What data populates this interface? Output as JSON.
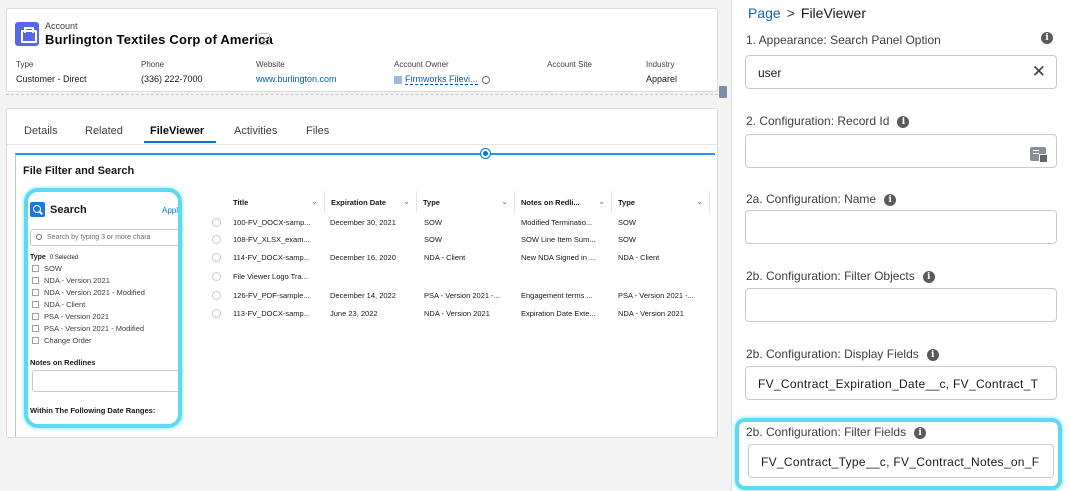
{
  "record": {
    "object_type": "Account",
    "name": "Burlington Textiles Corp of America",
    "hierarchy_icon": "hierarchy-icon",
    "fields": [
      {
        "label": "Type",
        "value": "Customer - Direct"
      },
      {
        "label": "Phone",
        "value": "(336) 222-7000"
      },
      {
        "label": "Website",
        "value": "www.burlington.com"
      },
      {
        "label": "Account Owner",
        "value": "Firmworks Filevi..."
      },
      {
        "label": "Account Site",
        "value": ""
      },
      {
        "label": "Industry",
        "value": "Apparel"
      }
    ]
  },
  "tabs": [
    "Details",
    "Related",
    "FileViewer",
    "Activities",
    "Files"
  ],
  "active_tab": "FileViewer",
  "component": {
    "title": "File Filter and Search",
    "search": {
      "title": "Search",
      "apply_label": "Appl",
      "placeholder": "Search by typing 3 or more chara",
      "type_label": "Type",
      "selected_count": "0 Selected",
      "options": [
        "SOW",
        "NDA - Version 2021",
        "NDA - Version 2021 - Modified",
        "NDA - Client",
        "PSA - Version 2021",
        "PSA - Version 2021 - Modified",
        "Change Order"
      ],
      "notes_label": "Notes on Redlines",
      "date_label": "Within The Following Date Ranges:"
    },
    "table": {
      "columns": [
        "Title",
        "Expiration Date",
        "Type",
        "Notes on Redli...",
        "Type"
      ],
      "rows": [
        [
          "100-FV_DOCX-samp...",
          "December 30, 2021",
          "SOW",
          "Modified Terminatio...",
          "SOW"
        ],
        [
          "108-FV_XLSX_exam...",
          "",
          "SOW",
          "SOW Line Item Sum...",
          "SOW"
        ],
        [
          "114-FV_DOCX-samp...",
          "December 16, 2020",
          "NDA - Client",
          "New NDA Signed in ...",
          "NDA - Client"
        ],
        [
          "File Viewer Logo Tra...",
          "",
          "",
          "",
          ""
        ],
        [
          "126-FV_PDF-sample...",
          "December 14, 2022",
          "PSA - Version 2021 -...",
          "Engagement terms ...",
          "PSA - Version 2021 -..."
        ],
        [
          "113-FV_DOCX-samp...",
          "June 23, 2022",
          "NDA - Version 2021",
          "Expiration Date Exte...",
          "NDA - Version 2021"
        ]
      ]
    }
  },
  "panel": {
    "breadcrumb": {
      "root": "Page",
      "separator": ">",
      "current": "FileViewer"
    },
    "fields": {
      "appearance": {
        "label": "1. Appearance: Search Panel Option",
        "value": "user"
      },
      "record_id": {
        "label": "2. Configuration: Record Id",
        "value": ""
      },
      "name": {
        "label": "2a. Configuration: Name",
        "value": ""
      },
      "filter_objects": {
        "label": "2b. Configuration: Filter Objects",
        "value": ""
      },
      "display_fields": {
        "label": "2b. Configuration: Display Fields",
        "value": "FV_Contract_Expiration_Date__c, FV_Contract_T"
      },
      "filter_fields": {
        "label": "2b. Configuration: Filter Fields",
        "value": "FV_Contract_Type__c, FV_Contract_Notes_on_F"
      }
    }
  },
  "colors": {
    "highlight": "#5ed9f2",
    "link": "#0176d3",
    "brand_icon": "#5867e8"
  }
}
